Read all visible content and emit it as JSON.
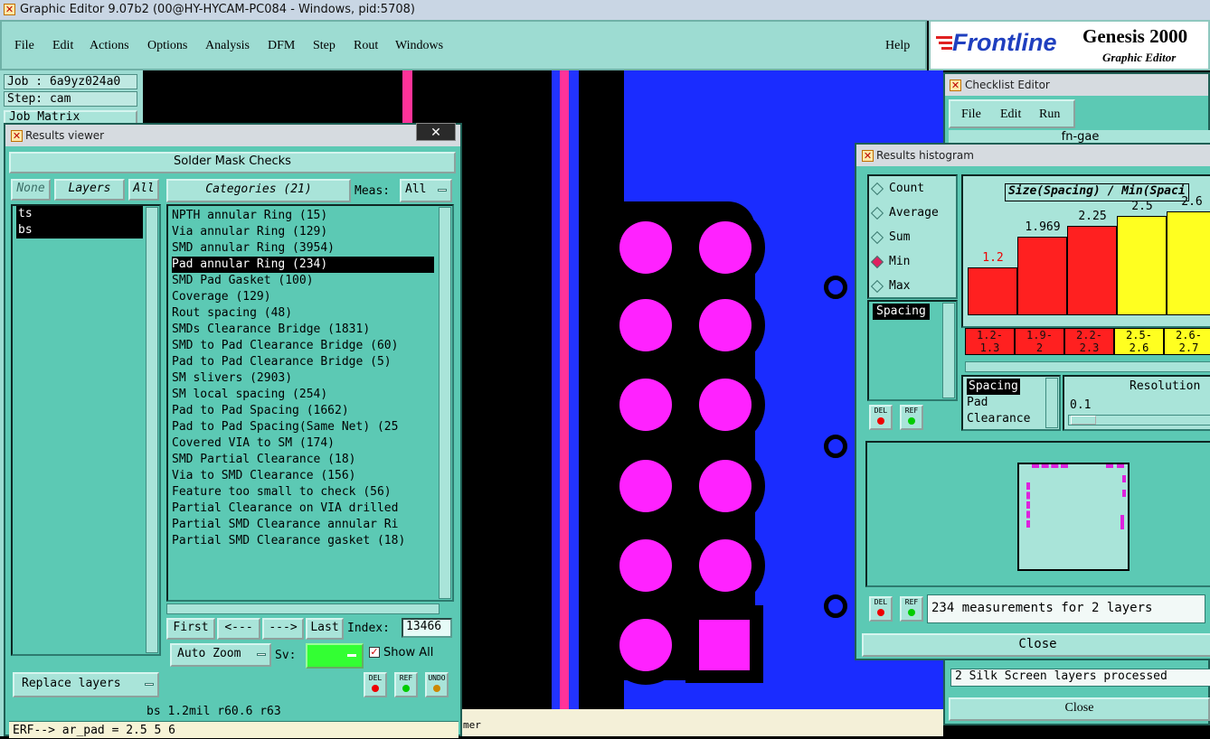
{
  "app": {
    "title": "Graphic Editor 9.07b2 (00@HY-HYCAM-PC084 - Windows, pid:5708)"
  },
  "menu": {
    "items": [
      "File",
      "Edit",
      "Actions",
      "Options",
      "Analysis",
      "DFM",
      "Step",
      "Rout",
      "Windows"
    ],
    "help": "Help"
  },
  "brand": {
    "logo": "Frontline",
    "product": "Genesis 2000",
    "subtitle": "Graphic Editor"
  },
  "job": {
    "job": "Job : 6a9yz024a0",
    "step": "Step: cam",
    "matrix": "Job Matrix"
  },
  "results_viewer": {
    "title": "Results viewer",
    "heading": "Solder Mask Checks",
    "none": "None",
    "layers": "Layers",
    "all": "All",
    "categories_btn": "Categories (21)",
    "meas_label": "Meas:",
    "meas_value": "All",
    "layer_list": [
      "ts",
      "bs"
    ],
    "categories": [
      "NPTH annular Ring (15)",
      "Via annular Ring (129)",
      "SMD annular Ring (3954)",
      "Pad annular Ring (234)",
      "SMD Pad Gasket (100)",
      "Coverage (129)",
      "Rout spacing (48)",
      "SMDs Clearance Bridge (1831)",
      "SMD to Pad Clearance Bridge (60)",
      "Pad to Pad Clearance Bridge (5)",
      "SM slivers (2903)",
      "SM local spacing (254)",
      "Pad to Pad Spacing (1662)",
      "Pad to Pad Spacing(Same Net) (25",
      "Covered VIA to SM (174)",
      "SMD Partial Clearance (18)",
      "Via to SMD Clearance (156)",
      "Feature too small to check (56)",
      "Partial Clearance on VIA drilled",
      "Partial SMD Clearance annular Ri",
      "Partial SMD Clearance gasket (18)"
    ],
    "selected_category": 3,
    "first": "First",
    "prev": "<---",
    "next": "--->",
    "last": "Last",
    "index_label": "Index:",
    "index_value": "13466",
    "auto_zoom": "Auto Zoom",
    "sv_label": "Sv:",
    "show_all": "Show All",
    "replace_layers": "Replace layers",
    "status": "bs 1.2mil   r60.6   r63",
    "erf": "ERF--> ar_pad = 2.5 5 6",
    "del": "DEL",
    "ref": "REF",
    "undo": "UNDO"
  },
  "histogram": {
    "title": "Results histogram",
    "options": [
      "Count",
      "Average",
      "Sum",
      "Min",
      "Max"
    ],
    "selected_option": "Min",
    "chart_title": "Size(Spacing) / Min(Spaci",
    "attr_list": [
      "Spacing"
    ],
    "attr_list2": [
      "Spacing",
      "Pad",
      "Clearance"
    ],
    "resolution_label": "Resolution",
    "resolution_value": "0.1",
    "measurements": "234 measurements for 2 layers",
    "close": "Close",
    "del": "DEL",
    "ref": "REF"
  },
  "chart_data": {
    "type": "bar",
    "title": "Size(Spacing) / Min(Spaci",
    "categories": [
      "1.2-1.3",
      "1.9-2",
      "2.2-2.3",
      "2.5-2.6",
      "2.6-2.7"
    ],
    "bin_labels": [
      [
        "1.2-",
        "1.3"
      ],
      [
        "1.9-",
        "2"
      ],
      [
        "2.2-",
        "2.3"
      ],
      [
        "2.5-",
        "2.6"
      ],
      [
        "2.6-",
        "2.7"
      ]
    ],
    "values": [
      1.2,
      1.969,
      2.25,
      2.5,
      2.6
    ],
    "value_labels": [
      "1.2",
      "1.969",
      "2.25",
      "2.5",
      "2.6"
    ],
    "colors": [
      "#ff2020",
      "#ff2020",
      "#ff2020",
      "#ffff20",
      "#ffff20"
    ],
    "ylim": [
      0,
      2.9
    ]
  },
  "checklist": {
    "title": "Checklist Editor",
    "menu": [
      "File",
      "Edit",
      "Run"
    ],
    "name": "fn-gae",
    "status": "2 Silk Screen layers processed",
    "close": "Close"
  },
  "canvas": {
    "footer_text": "mer"
  },
  "colors": {
    "panel": "#5cc9b4",
    "menubar": "#9ddcd2",
    "copper": "#1a2cff",
    "pad": "#ff22ff"
  }
}
